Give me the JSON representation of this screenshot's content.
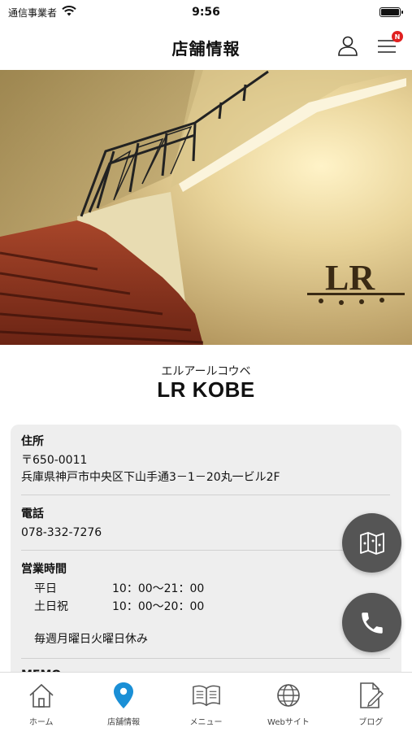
{
  "status_bar": {
    "carrier": "通信事業者",
    "time": "9:56"
  },
  "header": {
    "title": "店舗情報",
    "notification_badge": "N"
  },
  "shop": {
    "kana": "エルアールコウベ",
    "name": "LR KOBE"
  },
  "address": {
    "label": "住所",
    "postal": "〒650-0011",
    "line": "兵庫県神戸市中央区下山手通3－1－20丸一ビル2F"
  },
  "phone": {
    "label": "電話",
    "number": "078-332-7276"
  },
  "hours": {
    "label": "営業時間",
    "rows": [
      {
        "day": "平日",
        "time": "10：00〜21：00"
      },
      {
        "day": "土日祝",
        "time": "10：00〜20：00"
      }
    ],
    "note": "毎週月曜日火曜日休み"
  },
  "memo": {
    "label": "MEMO"
  },
  "tabs": [
    {
      "label": "ホーム",
      "icon": "home-icon"
    },
    {
      "label": "店舗情報",
      "icon": "map-pin-icon",
      "active": true
    },
    {
      "label": "メニュー",
      "icon": "book-icon"
    },
    {
      "label": "Webサイト",
      "icon": "globe-icon"
    },
    {
      "label": "ブログ",
      "icon": "document-edit-icon"
    }
  ],
  "colors": {
    "accent": "#1a8fd6",
    "fab": "#555555",
    "card": "#eeeeee",
    "badge": "#e02020"
  }
}
